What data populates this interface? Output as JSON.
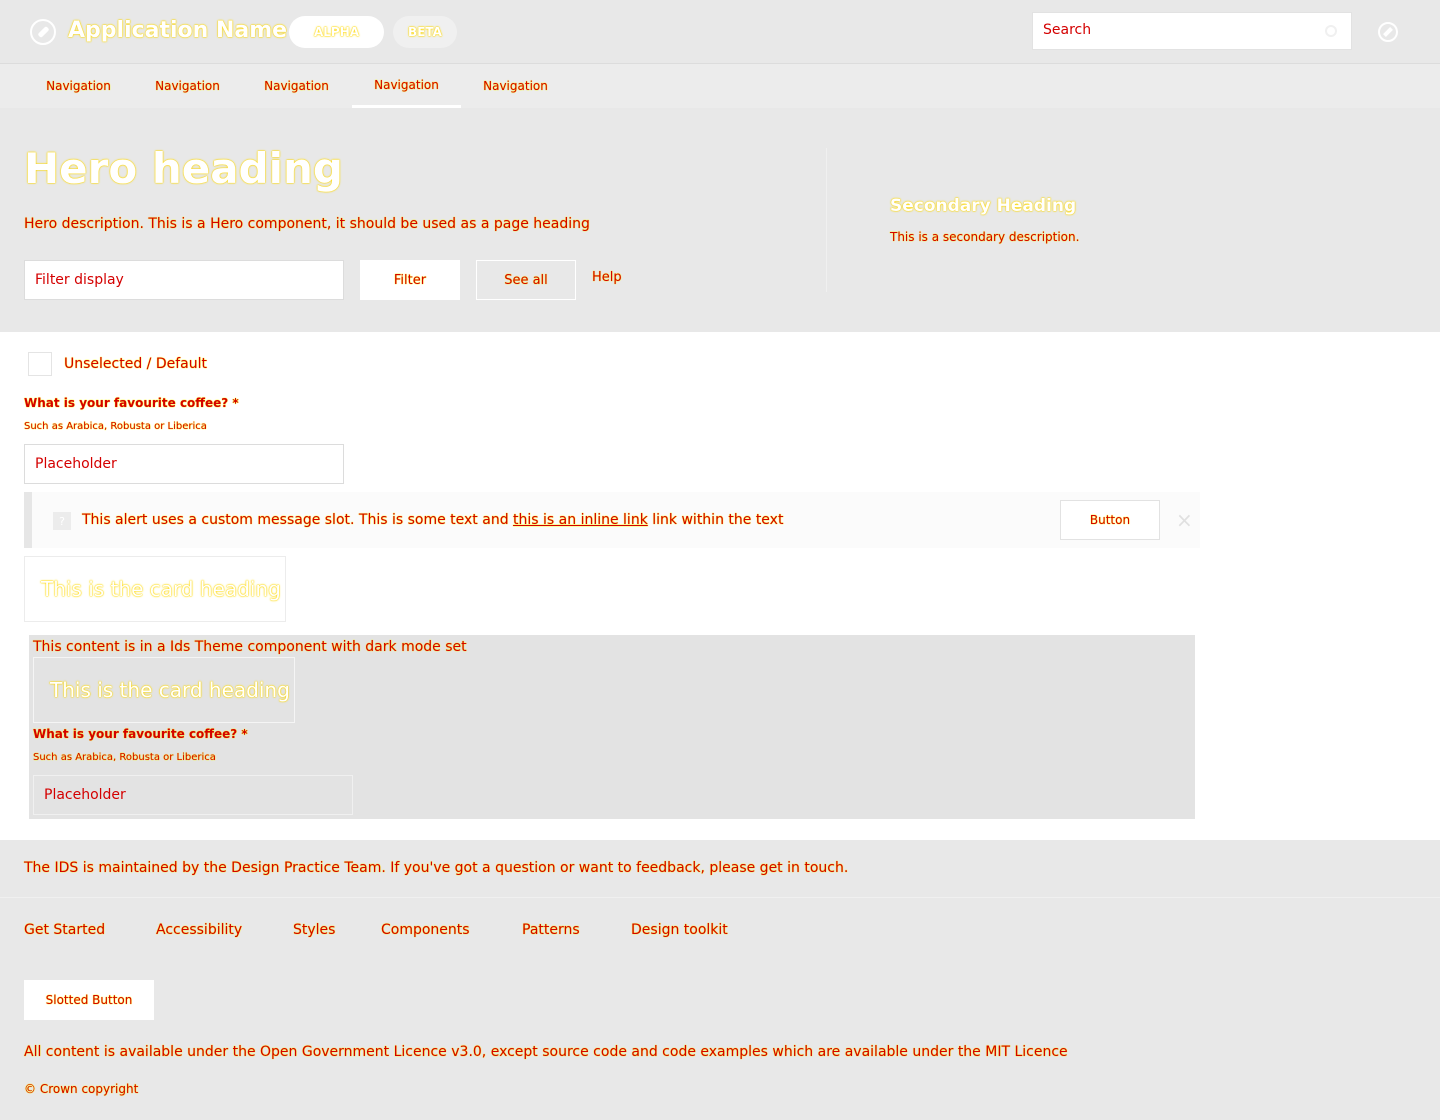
{
  "header": {
    "app_name": "Application Name",
    "badge_alpha": "ALPHA",
    "badge_beta": "BETA",
    "search_placeholder": "Search"
  },
  "nav": {
    "items": [
      {
        "label": "Navigation"
      },
      {
        "label": "Navigation"
      },
      {
        "label": "Navigation"
      },
      {
        "label": "Navigation",
        "active": true
      },
      {
        "label": "Navigation"
      }
    ]
  },
  "hero": {
    "heading": "Hero heading",
    "description": "Hero description. This is a Hero component, it should be used as a page heading",
    "filter_placeholder": "Filter display",
    "filter_button": "Filter",
    "see_all_button": "See all",
    "help_link": "Help",
    "secondary_heading": "Secondary Heading",
    "secondary_description": "This is a secondary description."
  },
  "form": {
    "checkbox_label": "Unselected / Default",
    "question_label": "What is your favourite coffee? *",
    "question_hint": "Such as Arabica, Robusta or Liberica",
    "input_placeholder": "Placeholder"
  },
  "alert": {
    "text_before": "This alert uses a custom message slot. This is some text and ",
    "link_text": "this is an inline link",
    "text_after": " link within the text",
    "button": "Button",
    "icon": "question-icon",
    "close_icon": "×"
  },
  "card": {
    "heading": "This is the card heading"
  },
  "dark_theme": {
    "text": "This content is in a Ids Theme component with dark mode set",
    "card_heading": "This is the card heading",
    "question_label": "What is your favourite coffee? *",
    "question_hint": "Such as Arabica, Robusta or Liberica",
    "input_placeholder": "Placeholder"
  },
  "footer": {
    "message": "The IDS is maintained by the Design Practice Team. If you've got a question or want to feedback, please get in touch.",
    "links": [
      {
        "label": "Get Started"
      },
      {
        "label": "Accessibility"
      },
      {
        "label": "Styles"
      },
      {
        "label": "Components"
      },
      {
        "label": "Patterns"
      },
      {
        "label": "Design toolkit"
      }
    ],
    "slotted_button": "Slotted Button",
    "license": "All content is available under the Open Government Licence v3.0, except source code and code examples which are available under the MIT Licence",
    "copyright": "© Crown copyright"
  }
}
